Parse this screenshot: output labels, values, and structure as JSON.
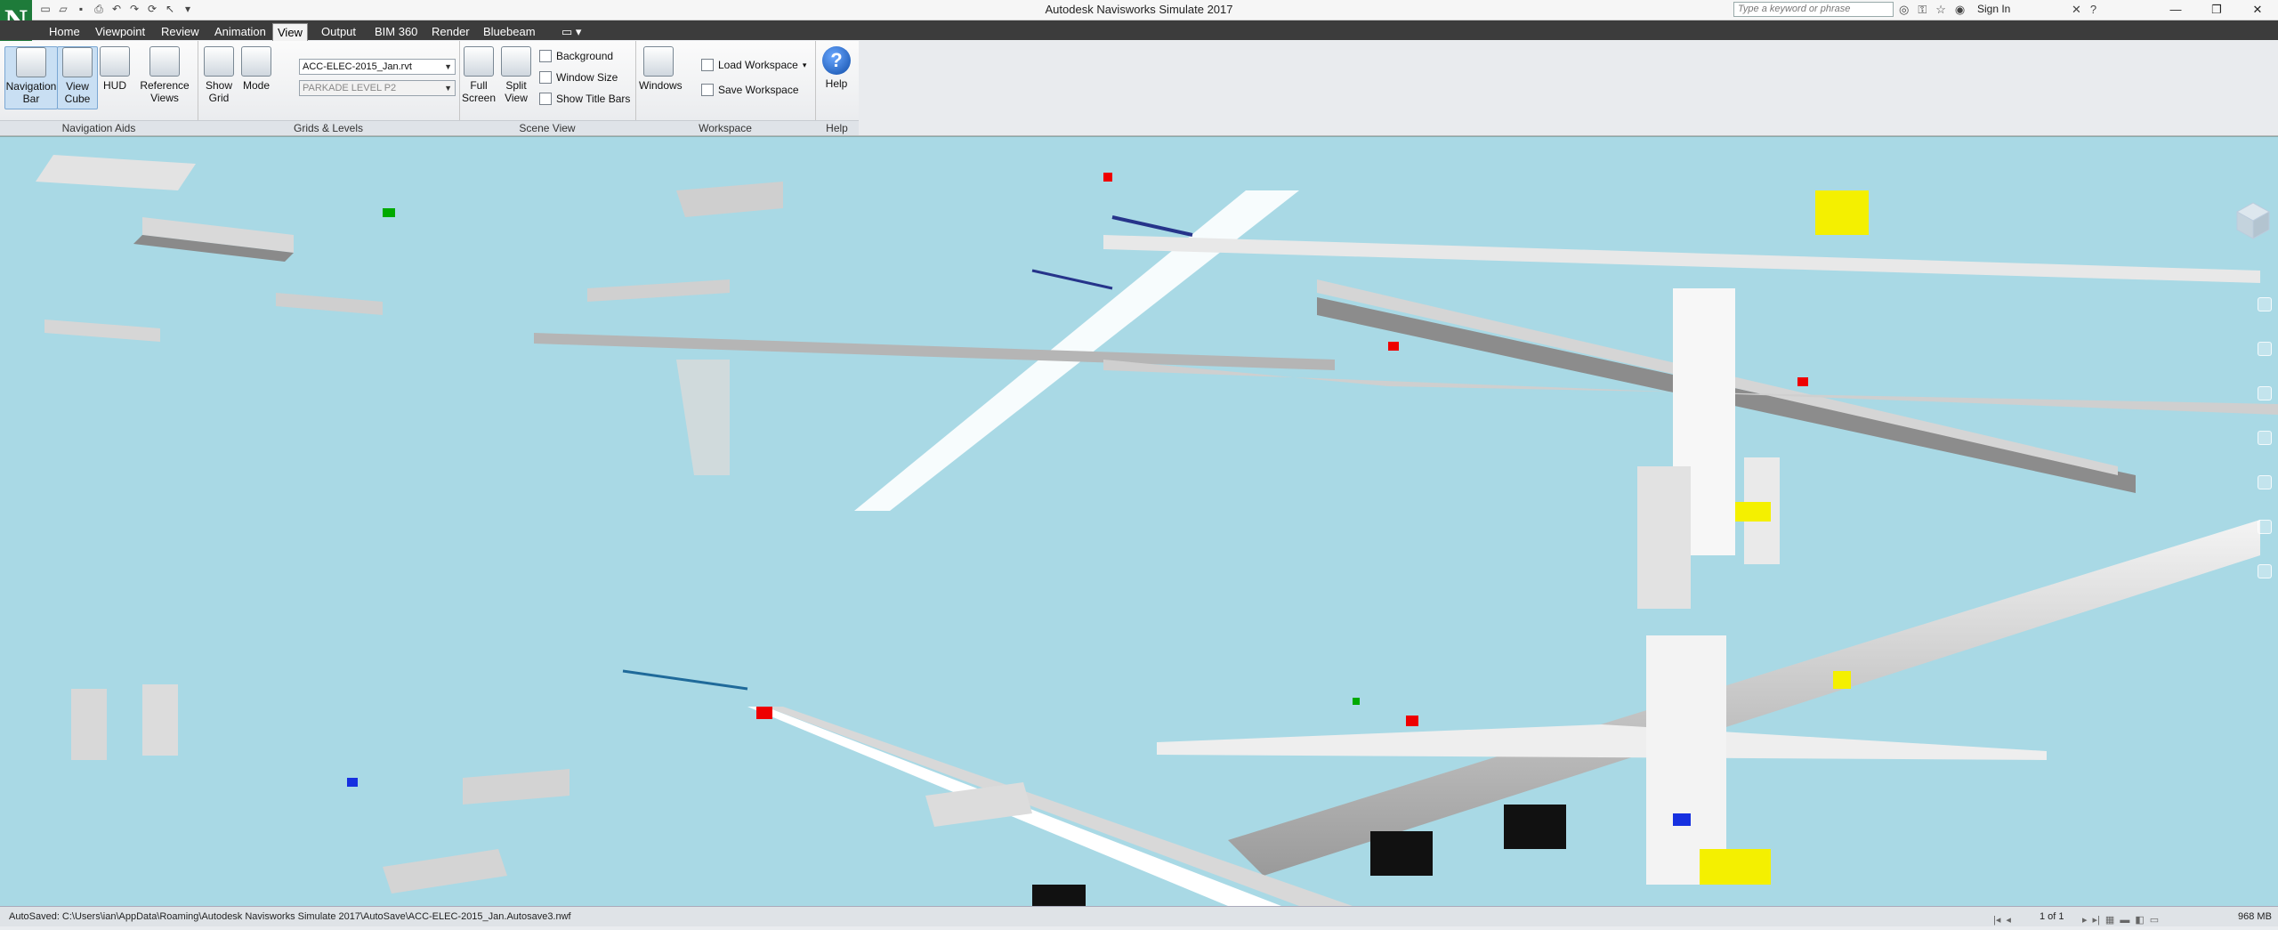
{
  "app": {
    "logo_letter": "N",
    "title": "Autodesk Navisworks Simulate 2017",
    "search_placeholder": "Type a keyword or phrase",
    "sign_in": "Sign In"
  },
  "tabs": [
    {
      "label": "Home"
    },
    {
      "label": "Viewpoint"
    },
    {
      "label": "Review"
    },
    {
      "label": "Animation"
    },
    {
      "label": "View",
      "active": true
    },
    {
      "label": "Output"
    },
    {
      "label": "BIM 360"
    },
    {
      "label": "Render"
    },
    {
      "label": "Bluebeam"
    }
  ],
  "ribbon": {
    "navigation_aids": {
      "label": "Navigation Aids",
      "navigation_bar": "Navigation Bar",
      "view_cube": "View Cube",
      "hud": "HUD",
      "reference_views": "Reference Views"
    },
    "grids_levels": {
      "label": "Grids & Levels",
      "show_grid": "Show Grid",
      "mode": "Mode",
      "model_file": "ACC-ELEC-2015_Jan.rvt",
      "level": "PARKADE LEVEL P2"
    },
    "scene_view": {
      "label": "Scene View",
      "full_screen": "Full Screen",
      "split_view": "Split View",
      "background": "Background",
      "window_size": "Window Size",
      "show_title_bars": "Show Title Bars"
    },
    "workspace": {
      "label": "Workspace",
      "windows": "Windows",
      "load_workspace": "Load Workspace",
      "save_workspace": "Save Workspace"
    },
    "help": {
      "label": "Help",
      "help": "Help"
    }
  },
  "status": {
    "autosave": "AutoSaved: C:\\Users\\ian\\AppData\\Roaming\\Autodesk Navisworks Simulate 2017\\AutoSave\\ACC-ELEC-2015_Jan.Autosave3.nwf",
    "page": "1 of 1",
    "memory": "968 MB"
  },
  "colors": {
    "viewport_bg": "#a9d9e5",
    "tabbar_bg": "#3c3c3c"
  }
}
